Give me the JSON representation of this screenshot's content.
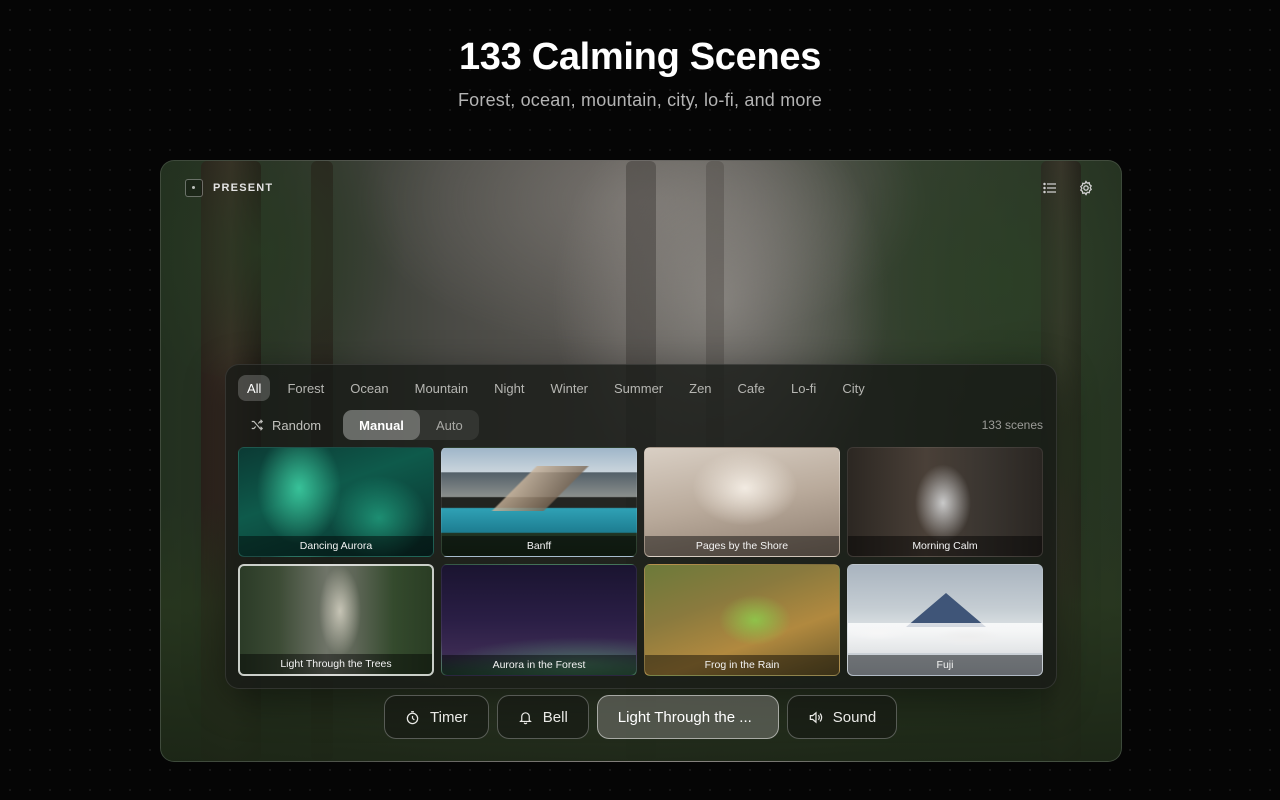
{
  "hero": {
    "title": "133 Calming Scenes",
    "subtitle": "Forest, ocean, mountain, city, lo-fi, and more"
  },
  "app": {
    "brand": "PRESENT",
    "icons": {
      "list": "list-icon",
      "settings": "gear-icon",
      "logo": "logo-mark"
    },
    "categories": [
      {
        "label": "All",
        "active": true
      },
      {
        "label": "Forest"
      },
      {
        "label": "Ocean"
      },
      {
        "label": "Mountain"
      },
      {
        "label": "Night"
      },
      {
        "label": "Winter"
      },
      {
        "label": "Summer"
      },
      {
        "label": "Zen"
      },
      {
        "label": "Cafe"
      },
      {
        "label": "Lo-fi"
      },
      {
        "label": "City"
      }
    ],
    "modes": {
      "random": "Random",
      "manual": "Manual",
      "auto": "Auto",
      "selected": "Manual"
    },
    "scene_count": "133 scenes",
    "scenes": [
      {
        "label": "Dancing Aurora"
      },
      {
        "label": "Banff"
      },
      {
        "label": "Pages by the Shore"
      },
      {
        "label": "Morning Calm"
      },
      {
        "label": "Light Through the Trees",
        "selected": true
      },
      {
        "label": "Aurora in the Forest"
      },
      {
        "label": "Frog in the Rain"
      },
      {
        "label": "Fuji"
      }
    ],
    "dock": {
      "timer": "Timer",
      "bell": "Bell",
      "now_playing": "Light Through the ...",
      "sound": "Sound"
    }
  },
  "colors": {
    "page_bg": "#050505",
    "panel_bg": "#181a16",
    "accent_active": "#ffffff"
  }
}
